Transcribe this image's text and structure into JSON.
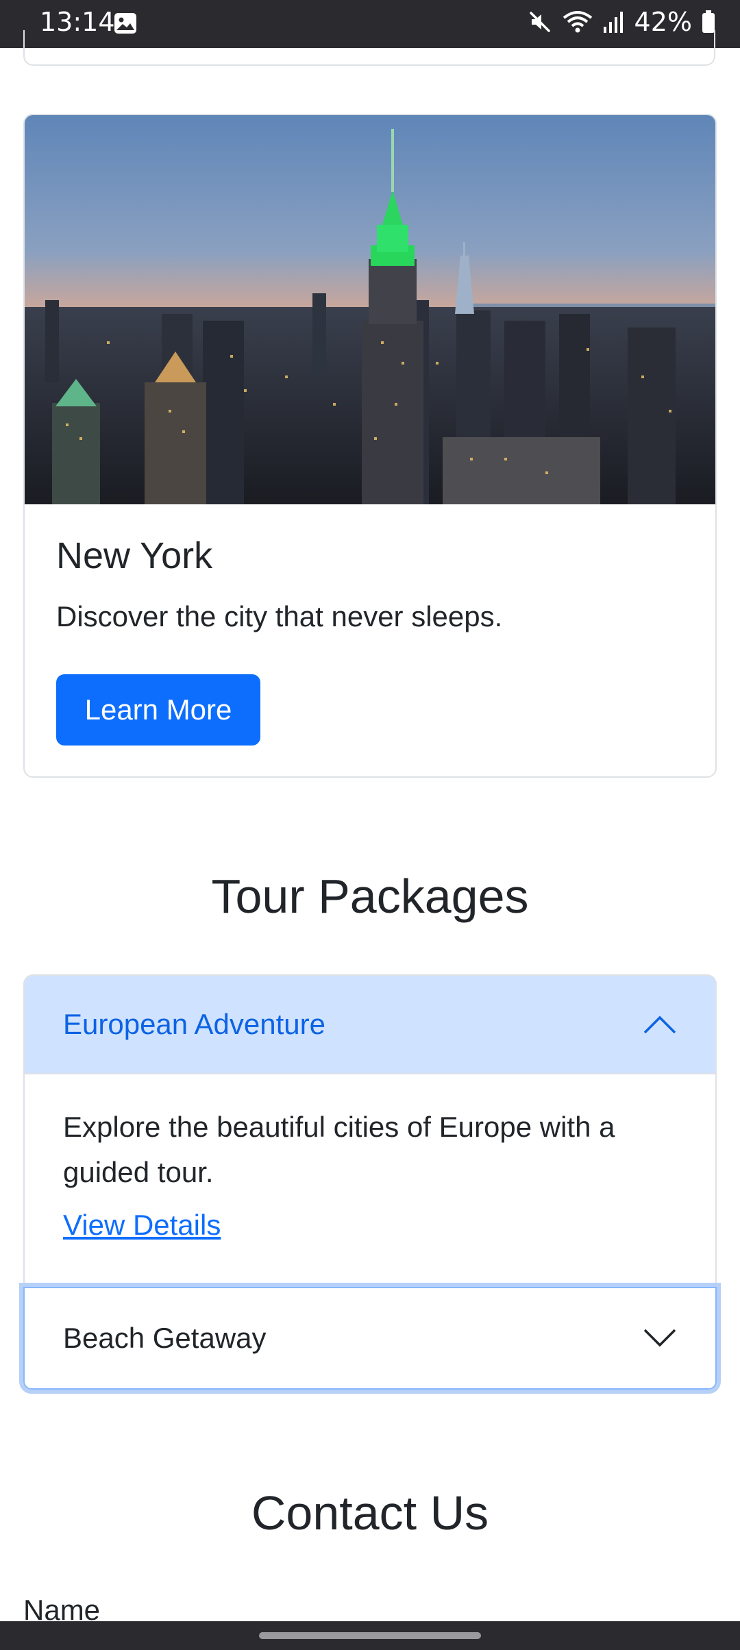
{
  "status_bar": {
    "time": "13:14",
    "battery": "42%"
  },
  "city_card": {
    "title": "New York",
    "description": "Discover the city that never sleeps.",
    "button_label": "Learn More"
  },
  "tour_packages": {
    "heading": "Tour Packages",
    "items": [
      {
        "title": "European Adventure",
        "expanded": true,
        "body": "Explore the beautiful cities of Europe with a guided tour.",
        "link": "View Details"
      },
      {
        "title": "Beach Getaway",
        "expanded": false
      }
    ]
  },
  "contact": {
    "heading": "Contact Us",
    "name_label": "Name"
  },
  "colors": {
    "primary": "#0d6efd",
    "accordion_active_bg": "#cfe2ff",
    "accordion_active_text": "#0c63e4"
  }
}
